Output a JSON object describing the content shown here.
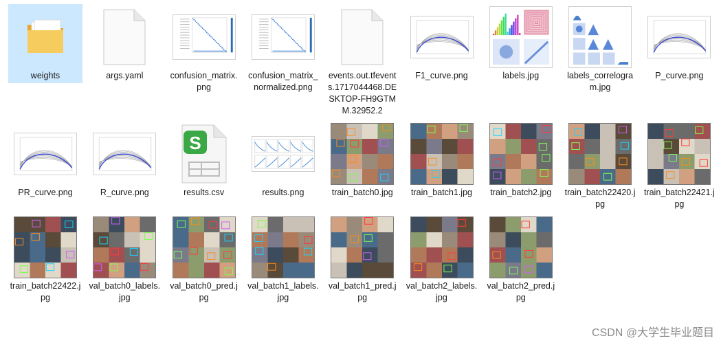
{
  "files": [
    {
      "label": "weights",
      "kind": "folder",
      "selected": true
    },
    {
      "label": "args.yaml",
      "kind": "doc"
    },
    {
      "label": "confusion_matrix.png",
      "kind": "matrix"
    },
    {
      "label": "confusion_matrix_normalized.png",
      "kind": "matrix"
    },
    {
      "label": "events.out.tfevents.1717044468.DESKTOP-FH9GTMM.32952.2",
      "kind": "doc"
    },
    {
      "label": "F1_curve.png",
      "kind": "curve"
    },
    {
      "label": "labels.jpg",
      "kind": "labels"
    },
    {
      "label": "labels_correlogram.jpg",
      "kind": "correlogram"
    },
    {
      "label": "P_curve.png",
      "kind": "curve"
    },
    {
      "label": "PR_curve.png",
      "kind": "curve"
    },
    {
      "label": "R_curve.png",
      "kind": "curve"
    },
    {
      "label": "results.csv",
      "kind": "csv"
    },
    {
      "label": "results.png",
      "kind": "results"
    },
    {
      "label": "train_batch0.jpg",
      "kind": "photo"
    },
    {
      "label": "train_batch1.jpg",
      "kind": "photo"
    },
    {
      "label": "train_batch2.jpg",
      "kind": "photo"
    },
    {
      "label": "train_batch22420.jpg",
      "kind": "photo"
    },
    {
      "label": "train_batch22421.jpg",
      "kind": "photo"
    },
    {
      "label": "train_batch22422.jpg",
      "kind": "photo"
    },
    {
      "label": "val_batch0_labels.jpg",
      "kind": "photo"
    },
    {
      "label": "val_batch0_pred.jpg",
      "kind": "photo"
    },
    {
      "label": "val_batch1_labels.jpg",
      "kind": "photo"
    },
    {
      "label": "val_batch1_pred.jpg",
      "kind": "photo"
    },
    {
      "label": "val_batch2_labels.jpg",
      "kind": "photo"
    },
    {
      "label": "val_batch2_pred.jpg",
      "kind": "photo"
    }
  ],
  "watermark": "CSDN @大学生毕业题目",
  "colors": {
    "selection": "#cce8ff",
    "folder": "#f4c04e",
    "csv": "#3aa845"
  }
}
